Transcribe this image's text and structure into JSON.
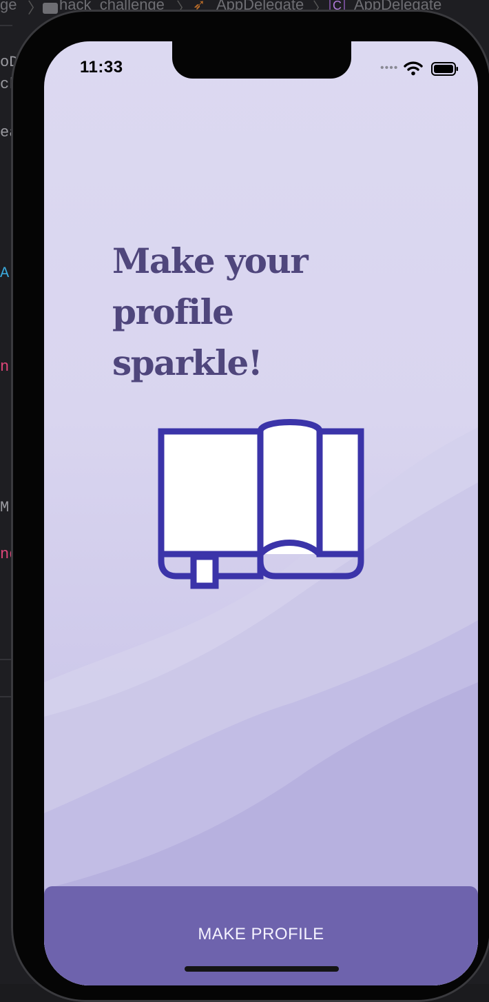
{
  "xcode": {
    "breadcrumb": [
      "ge",
      "hack_challenge",
      "AppDelegate",
      "AppDelegate"
    ],
    "side_fragments": [
      "oD",
      "ck",
      "ea",
      "A",
      "n",
      "M",
      "nd"
    ]
  },
  "status_bar": {
    "time": "11:33",
    "signal_dots": "••••"
  },
  "onboarding": {
    "headline_line1": "Make your profile",
    "headline_line2": "sparkle!"
  },
  "button": {
    "label": "MAKE PROFILE"
  },
  "colors": {
    "headline": "#4f467c",
    "book_stroke": "#3b34a9",
    "button_bg": "#6e63ad",
    "screen_bg": "#dcd9f1"
  }
}
